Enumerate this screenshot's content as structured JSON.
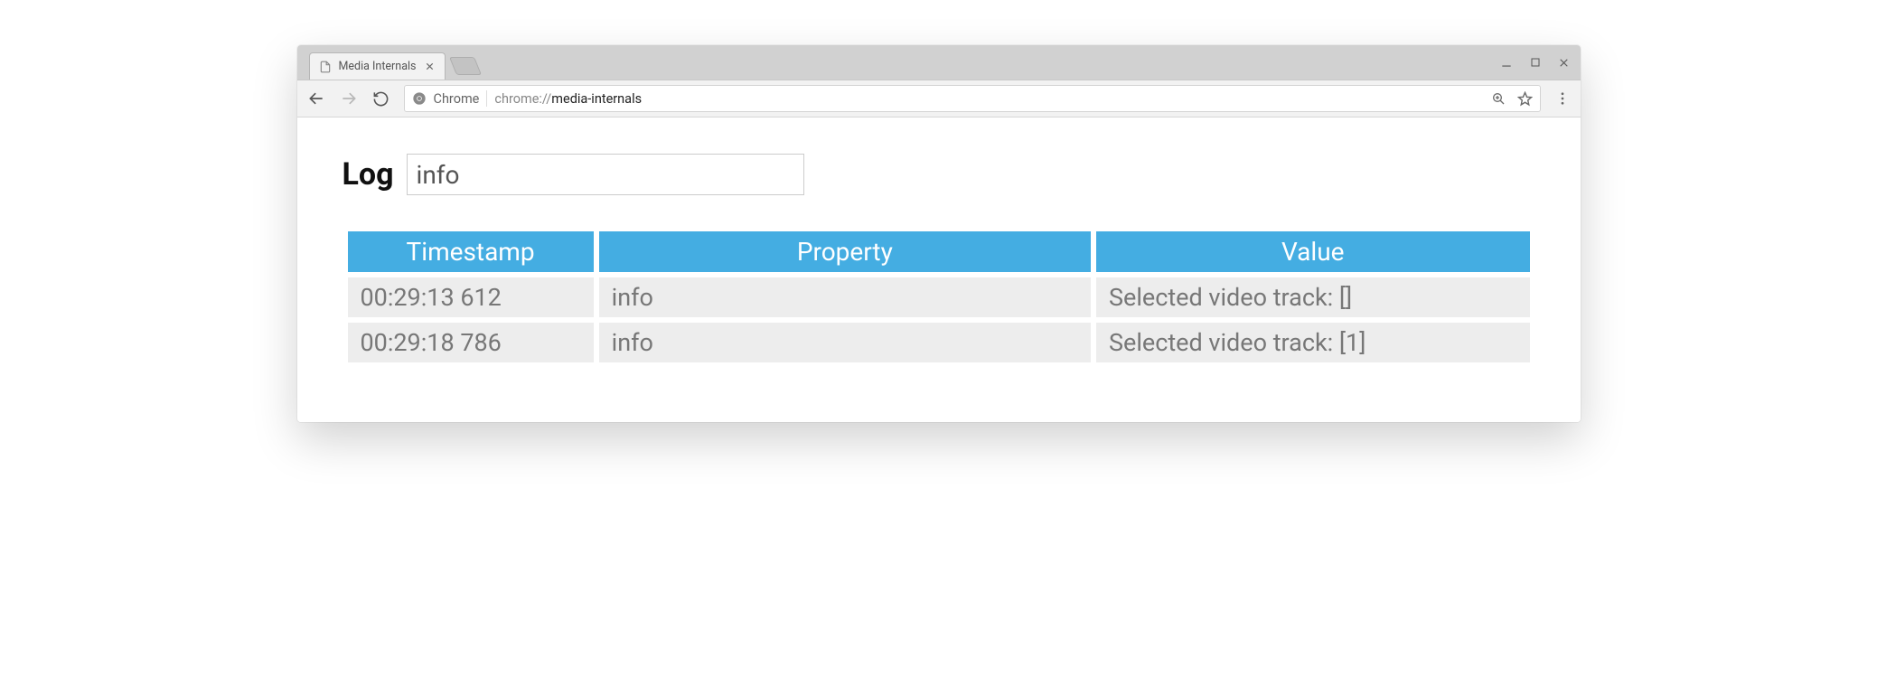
{
  "browser": {
    "tab_title": "Media Internals",
    "omnibox": {
      "scheme_label": "Chrome",
      "path_prefix": "chrome://",
      "path_main": "media-internals"
    }
  },
  "page": {
    "heading": "Log",
    "filter_value": "info"
  },
  "table": {
    "headers": {
      "timestamp": "Timestamp",
      "property": "Property",
      "value": "Value"
    },
    "rows": [
      {
        "timestamp": "00:29:13 612",
        "property": "info",
        "value": "Selected video track: []"
      },
      {
        "timestamp": "00:29:18 786",
        "property": "info",
        "value": "Selected video track: [1]"
      }
    ]
  }
}
